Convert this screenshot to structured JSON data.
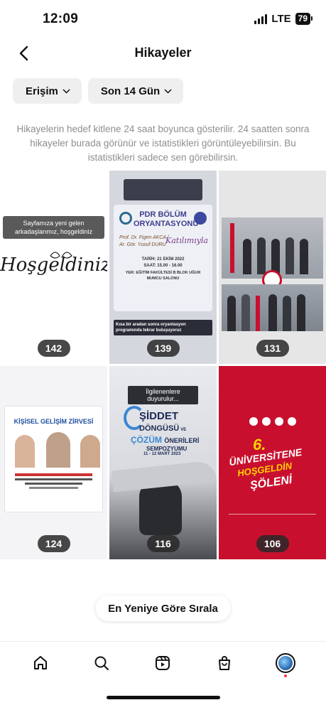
{
  "status": {
    "time": "12:09",
    "network": "LTE",
    "battery": "79"
  },
  "header": {
    "title": "Hikayeler",
    "back_icon": "chevron-left-icon"
  },
  "filters": [
    {
      "label": "Erişim"
    },
    {
      "label": "Son 14 Gün"
    }
  ],
  "info_text": "Hikayelerin hedef kitlene 24 saat boyunca gösterilir. 24 saatten sonra hikayeler burada görünür ve istatistikleri görüntüleyebilirsin. Bu istatistikleri sadece sen görebilirsin.",
  "stories": [
    {
      "count": "142",
      "caption": "Sayfamıza yeni gelen arkadaşlarımız, hoşgeldiniz",
      "script_text": "Hoşgeldiniz"
    },
    {
      "count": "139",
      "title": "PDR BÖLÜM ORYANTASYONU",
      "names": "Prof. Dr. Figen AKCA / Ar. Gör. Yusuf DURU",
      "script": "Katılımıyla",
      "date": "TARİH: 21 EKİM 2022",
      "time": "SAAT: 15.00 - 16.00",
      "place": "YER: EĞİTİM FAKÜLTESİ B BLOK UĞUR MUMCU SALONU",
      "footer": "Kısa bir aradan sonra oryantasyon programında tekrar buluşuyoruz"
    },
    {
      "count": "131"
    },
    {
      "count": "124",
      "title": "KİŞİSEL GELİŞİM ZİRVESİ"
    },
    {
      "count": "116",
      "header": "İlgilenenlere duyurulur...",
      "title1": "ŞİDDET",
      "title2": "DÖNGÜSÜ",
      "title2b": "VE",
      "title3": "ÇÖZÜM",
      "title3b": "ÖNERİLERİ",
      "title4": "SEMPOZYUMU",
      "dates": "11 - 12 MART 2023"
    },
    {
      "count": "106",
      "big": "6.",
      "line1": "ÜNİVERSİTENE",
      "line2": "HOŞGELDİN",
      "line3": "ŞÖLENİ"
    }
  ],
  "sort_button": "En Yeniye Göre Sırala",
  "tabs": [
    {
      "name": "home",
      "icon": "home-icon"
    },
    {
      "name": "search",
      "icon": "search-icon"
    },
    {
      "name": "reels",
      "icon": "reels-icon"
    },
    {
      "name": "shop",
      "icon": "shopping-bag-icon"
    },
    {
      "name": "profile",
      "icon": "profile-avatar-icon"
    }
  ],
  "colors": {
    "chip_bg": "#efefef",
    "info_text": "#8e8e8e",
    "badge_bg": "#282828",
    "red_story": "#c8102e",
    "notification": "#ff3040"
  }
}
